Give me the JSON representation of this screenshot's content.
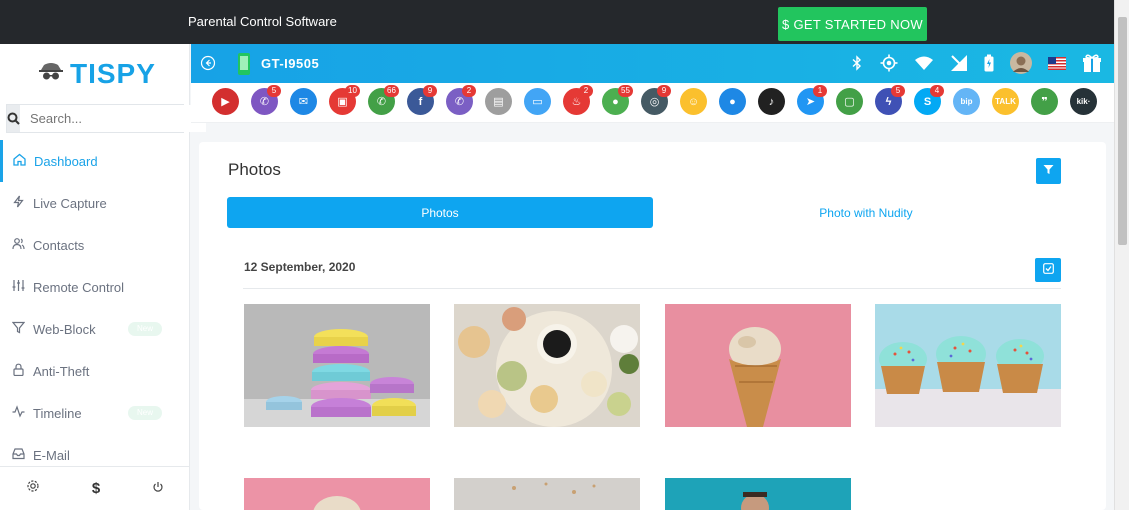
{
  "topbar": {
    "title": "Parental Control Software",
    "cta_label": "$ GET STARTED NOW"
  },
  "brand": {
    "name": "TISPY"
  },
  "search": {
    "placeholder": "Search..."
  },
  "sidebar": {
    "items": [
      {
        "label": "Dashboard",
        "icon": "home-icon",
        "active": true
      },
      {
        "label": "Live Capture",
        "icon": "bolt-icon"
      },
      {
        "label": "Contacts",
        "icon": "users-icon"
      },
      {
        "label": "Remote Control",
        "icon": "sliders-icon"
      },
      {
        "label": "Web-Block",
        "icon": "filter-icon",
        "badge": "New"
      },
      {
        "label": "Anti-Theft",
        "icon": "lock-icon"
      },
      {
        "label": "Timeline",
        "icon": "activity-icon",
        "badge": "New"
      },
      {
        "label": "E-Mail",
        "icon": "inbox-icon"
      }
    ]
  },
  "device": {
    "name": "GT-I9505"
  },
  "apps": [
    {
      "name": "screen-recorder",
      "color": "#d32f2f",
      "glyph": "▶",
      "count": ""
    },
    {
      "name": "calls",
      "color": "#7e57c2",
      "glyph": "✆",
      "count": "5"
    },
    {
      "name": "email",
      "color": "#1e88e5",
      "glyph": "✉",
      "count": ""
    },
    {
      "name": "gallery",
      "color": "#e53935",
      "glyph": "▣",
      "count": "10"
    },
    {
      "name": "whatsapp",
      "color": "#43a047",
      "glyph": "✆",
      "count": "66"
    },
    {
      "name": "facebook",
      "color": "#3b5998",
      "glyph": "f",
      "count": "9"
    },
    {
      "name": "viber",
      "color": "#7b5fc4",
      "glyph": "✆",
      "count": "2"
    },
    {
      "name": "clipboard",
      "color": "#9e9e9e",
      "glyph": "▤",
      "count": ""
    },
    {
      "name": "screen",
      "color": "#42a5f5",
      "glyph": "▭",
      "count": ""
    },
    {
      "name": "tinder",
      "color": "#e53935",
      "glyph": "♨",
      "count": "2"
    },
    {
      "name": "wechat",
      "color": "#4caf50",
      "glyph": "●",
      "count": "55"
    },
    {
      "name": "instagram",
      "color": "#455a64",
      "glyph": "◎",
      "count": "9"
    },
    {
      "name": "snapchat",
      "color": "#fbc02d",
      "glyph": "☺",
      "count": ""
    },
    {
      "name": "flickr",
      "color": "#1e88e5",
      "glyph": "●",
      "count": ""
    },
    {
      "name": "tiktok",
      "color": "#212121",
      "glyph": "♪",
      "count": ""
    },
    {
      "name": "telegram",
      "color": "#2196f3",
      "glyph": "➤",
      "count": "1"
    },
    {
      "name": "line",
      "color": "#43a047",
      "glyph": "▢",
      "count": ""
    },
    {
      "name": "messenger",
      "color": "#3f51b5",
      "glyph": "ϟ",
      "count": "5"
    },
    {
      "name": "skype",
      "color": "#03a9f4",
      "glyph": "S",
      "count": "4"
    },
    {
      "name": "bip",
      "color": "#64b5f6",
      "glyph": "bip",
      "count": ""
    },
    {
      "name": "kakaotalk",
      "color": "#fbc02d",
      "glyph": "TALK",
      "count": ""
    },
    {
      "name": "hangouts",
      "color": "#43a047",
      "glyph": "❞",
      "count": ""
    },
    {
      "name": "kik",
      "color": "#263238",
      "glyph": "kik·",
      "count": ""
    }
  ],
  "main": {
    "title": "Photos",
    "tabs": [
      {
        "label": "Photos"
      },
      {
        "label": "Photo with Nudity"
      }
    ],
    "date": "12 September, 2020"
  },
  "colors": {
    "accent": "#0ea5f0",
    "topbar": "#25282c",
    "cta": "#22c55e"
  }
}
